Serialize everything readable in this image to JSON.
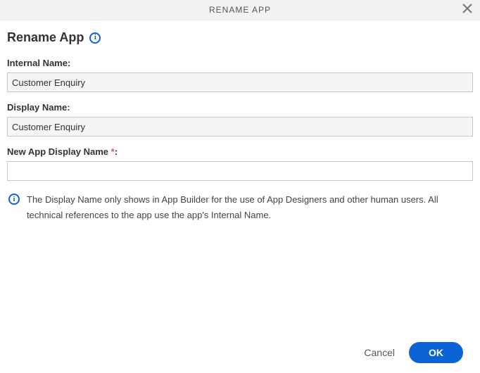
{
  "titlebar": {
    "title": "RENAME APP"
  },
  "header": {
    "title": "Rename App"
  },
  "fields": {
    "internal_name": {
      "label": "Internal Name:",
      "value": "Customer Enquiry"
    },
    "display_name": {
      "label": "Display Name:",
      "value": "Customer Enquiry"
    },
    "new_display_name": {
      "label_prefix": "New App Display Name ",
      "label_suffix": ":",
      "required_mark": "*",
      "value": ""
    }
  },
  "info": {
    "text": "The Display Name only shows in App Builder for the use of App Designers and other human users. All technical references to the app use the app's Internal Name."
  },
  "footer": {
    "cancel": "Cancel",
    "ok": "OK"
  }
}
